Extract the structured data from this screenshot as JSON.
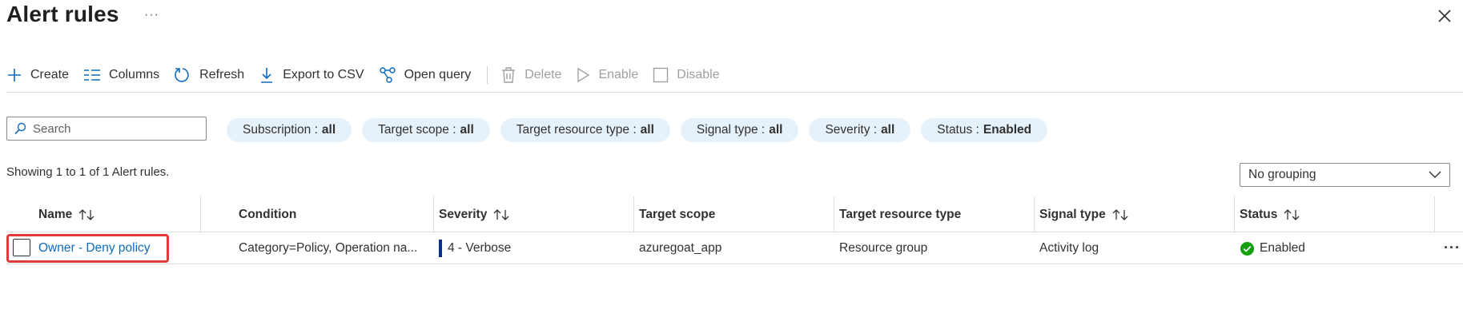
{
  "header": {
    "title": "Alert rules",
    "more": "···"
  },
  "toolbar": {
    "items": [
      {
        "label": "Create",
        "icon": "plus-icon",
        "enabled": true
      },
      {
        "label": "Columns",
        "icon": "columns-icon",
        "enabled": true
      },
      {
        "label": "Refresh",
        "icon": "refresh-icon",
        "enabled": true
      },
      {
        "label": "Export to CSV",
        "icon": "download-icon",
        "enabled": true
      },
      {
        "label": "Open query",
        "icon": "query-icon",
        "enabled": true
      },
      {
        "label": "Delete",
        "icon": "trash-icon",
        "enabled": false
      },
      {
        "label": "Enable",
        "icon": "play-icon",
        "enabled": false
      },
      {
        "label": "Disable",
        "icon": "square-icon",
        "enabled": false
      }
    ]
  },
  "search": {
    "placeholder": "Search",
    "value": ""
  },
  "filters": [
    {
      "label": "Subscription :",
      "value": "all"
    },
    {
      "label": "Target scope :",
      "value": "all"
    },
    {
      "label": "Target resource type :",
      "value": "all"
    },
    {
      "label": "Signal type :",
      "value": "all"
    },
    {
      "label": "Severity :",
      "value": "all"
    },
    {
      "label": "Status :",
      "value": "Enabled"
    }
  ],
  "summary": "Showing 1 to 1 of 1 Alert rules.",
  "grouping": {
    "selected": "No grouping"
  },
  "grid": {
    "columns": [
      {
        "label": "Name",
        "sortable": true
      },
      {
        "label": "Condition",
        "sortable": false
      },
      {
        "label": "Severity",
        "sortable": true
      },
      {
        "label": "Target scope",
        "sortable": false
      },
      {
        "label": "Target resource type",
        "sortable": false
      },
      {
        "label": "Signal type",
        "sortable": true
      },
      {
        "label": "Status",
        "sortable": true
      }
    ],
    "rows": [
      {
        "name": "Owner - Deny policy",
        "condition": "Category=Policy, Operation na...",
        "severity": "4 - Verbose",
        "target_scope": "azuregoat_app",
        "target_resource_type": "Resource group",
        "signal_type": "Activity log",
        "status": "Enabled",
        "more": "···"
      }
    ]
  },
  "colors": {
    "accent": "#0f6cbd",
    "pill_bg": "#e6f2fb",
    "highlight": "#e23b3b",
    "status_ok": "#13a10e",
    "severity_bar": "#0b2e8a"
  }
}
